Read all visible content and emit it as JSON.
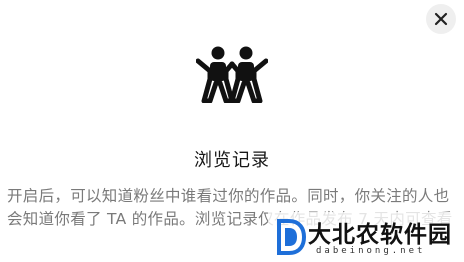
{
  "header": {
    "close_icon": "close-icon"
  },
  "hero": {
    "icon": "two-people-icon"
  },
  "main": {
    "title": "浏览记录",
    "description": "开启后，可以知道粉丝中谁看过你的作品。同时，你关注的人也会知道你看了 TA 的作品。浏览记录仅在作品发布 7 天内可查看"
  },
  "watermark": {
    "logo_icon": "d-logo-icon",
    "text": "大北农软件园",
    "subtext": "dabeinong.net"
  },
  "colors": {
    "background": "#ffffff",
    "title": "#161616",
    "description": "#7a7a7a",
    "close_button_bg": "#efefef",
    "logo_blue": "#1e6fd9"
  }
}
